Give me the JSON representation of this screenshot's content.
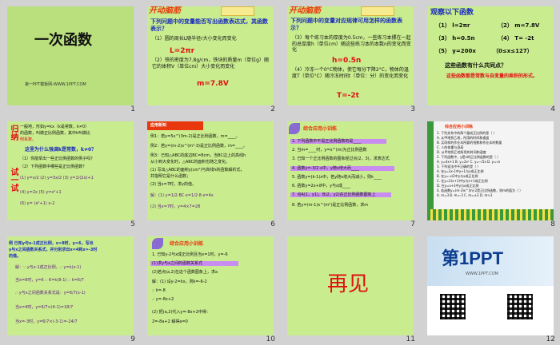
{
  "slides": [
    {
      "num": "1",
      "title": "一次函数",
      "footer": "第一PPT模板网-WWW.1PPT.COM"
    },
    {
      "num": "2",
      "header": "开动脑筋",
      "tag": "Bolt",
      "q": "下列问题中的变量能否写出函数表达式，其函数表示？",
      "items": [
        "（1）圆的周长L随半径r大小变化而变化",
        "L=2πr",
        "（2）铁的密度为7.8g/cm，铁块的质量m（单位g）随它的体积V（单位cm）大小变化而变化",
        "m=7.8V"
      ]
    },
    {
      "num": "3",
      "header": "开动脑筋",
      "tag": "Bolt",
      "q": "下列问题中的变量对应规律可用怎样的函数表示？",
      "items": [
        "（3）每个练习本的厚度为0.5cm，一些练习本摞在一起的总厚度h（单位cm）随这些练习本的本数n的变化而变化",
        "h=0.5n",
        "（4）冷冻一个0°C物体，使它每分下降2°C，物体的温度T（单位°C）随冷冻时间t（单位：分）的变化而变化",
        "T=-2t"
      ]
    },
    {
      "num": "4",
      "title": "观察以下函数",
      "funcs": [
        "（1） l=2πr",
        "（2） m=7.8V",
        "（3） h=0.5n",
        "（4） T= -2t",
        "（5） y=200x",
        "（0≤x≤127）"
      ],
      "q": "这些函数有什么共同点？",
      "a": "这些函数都是常数与自变量的乘积的形式。"
    },
    {
      "num": "5",
      "side": "归纳",
      "side2": "试一试",
      "lines": [
        "一般地，形如y=kx（k是常数，k≠0）",
        "的函数，叫做正比例函数，其中k叫做比",
        "例系数。",
        "这里为什么强调k是常数，k≠0？",
        "（1）你能举出一些正比例函数的例子吗？",
        "（2）下列函数中哪些是正比例函数？",
        "(1) y=x/2   (2) y=3x/2   (3) y=1/(2x)+1",
        "(4) y=2x   (5) y=x²+1",
        "(6) y= (a²+1) x-2"
      ]
    },
    {
      "num": "6",
      "header": "应用新知",
      "lines": [
        "例1：若y=5x^(3m-2)是正比例函数，m=____。",
        "例2：若y=(m-2)x^(m²-3)是正比例函数，m=____。",
        "例3：已知△ABC的底边BC=8cm，当BC边上的高线h",
        "从小到大变化时，△ABC的面积也随之变化。",
        "(1) 写出△ABC的面积y(cm²)与高线h的函数解析式，",
        "并指明它是什么函数；",
        "(2) 当x=7时，求y的值。",
        "解：(1) y=1/2·BC·x=1/2·8·x=4x",
        "(2) 当x=7时，y=4×7=28"
      ]
    },
    {
      "num": "7",
      "title": "综合应用小训练",
      "lines": [
        "1. 下列函数中不是正比例函数的是____",
        "2. 当m=____时，y=x^(m)为正比例函数",
        "3. 已知一个正比例函数的图象经过点(2，3)，求表达式",
        "4. 函数y=-3/2·x中，y随x增大而____",
        "5. 函数y=(k-1)x中，若y随x增大而减小，则k____",
        "6. 函数y=2x+8中，y与x成____",
        "7. 点A(1，y1)、B(2，y2)在正比例函数图象上",
        "8. 若y=(m-1)x^(m²)是正比例函数，求m"
      ]
    },
    {
      "num": "8",
      "title": "综合应用小训练",
      "lines": [
        "1. 下列关系中的两个量成正比例的是（  ）",
        "A. 从甲地到乙地，所用的时间和速度",
        "B. 买同样的作业本所要的钱数和作业本的数量",
        "C. 人的体重与身高",
        "D. 从甲地到乙地所用的时间和速度",
        "2. 下列函数中，y是x的正比例函数的是（  ）",
        "A. y=4x+1  B. y=2x²  C. y=-√5x  D. y=√x",
        "3. 下列说法中不正确的是（  ）",
        "A. 在y=3x-1中y+1与x成正比例",
        "B. 在y=-x/2中y与x成正比例",
        "C. 在y=2(x+1)中y与x+1成正比例",
        "D. 在y=x+3中y与x成正比例",
        "4. 若函数y=(m-3)x^|m|-2是正比例函数，则m的值为（  ）",
        "A. m=3   B. m=-3   C. m=±3   D. m>3"
      ]
    },
    {
      "num": "9",
      "lines": [
        "例  已知y与x-1成正比例，x=8时，y=6，写出",
        "y与x之间函数关系式，并分别求出x=4和x=-3时",
        "的值。",
        "解：∵ y与x-1成正比例，∴ y=k(x-1)",
        "当x=8时，y=6  ∴ 6=k(8-1)  ∴ k=6/7",
        "∴ y与x之间函数关系式是：y=6/7(x-1)",
        "当x=4时，y=6/7×(4-1)=18/7",
        "当x=-3时，y=6/7×(-3-1)=-24/7"
      ]
    },
    {
      "num": "10",
      "title": "综合应用小训练",
      "lines": [
        "1. 已知y-2与x成正比例且当x=1时，y=-6",
        "(1)求y与x之间的函数关系式",
        "(2)若点(a,2)在这个函数图象上，求a",
        "解：(1) 设y-2=kx，则k=-6-2",
        "∴ k=-8",
        "∴ y=-8x+2",
        "(2) 把(a,2)代入y=-8x+2中得：",
        "2=-8a+2  解得a=0"
      ]
    },
    {
      "num": "11",
      "text": "再见"
    },
    {
      "num": "12",
      "logo": "第1PPT",
      "sub": "WWW.1PPT.COM"
    }
  ]
}
